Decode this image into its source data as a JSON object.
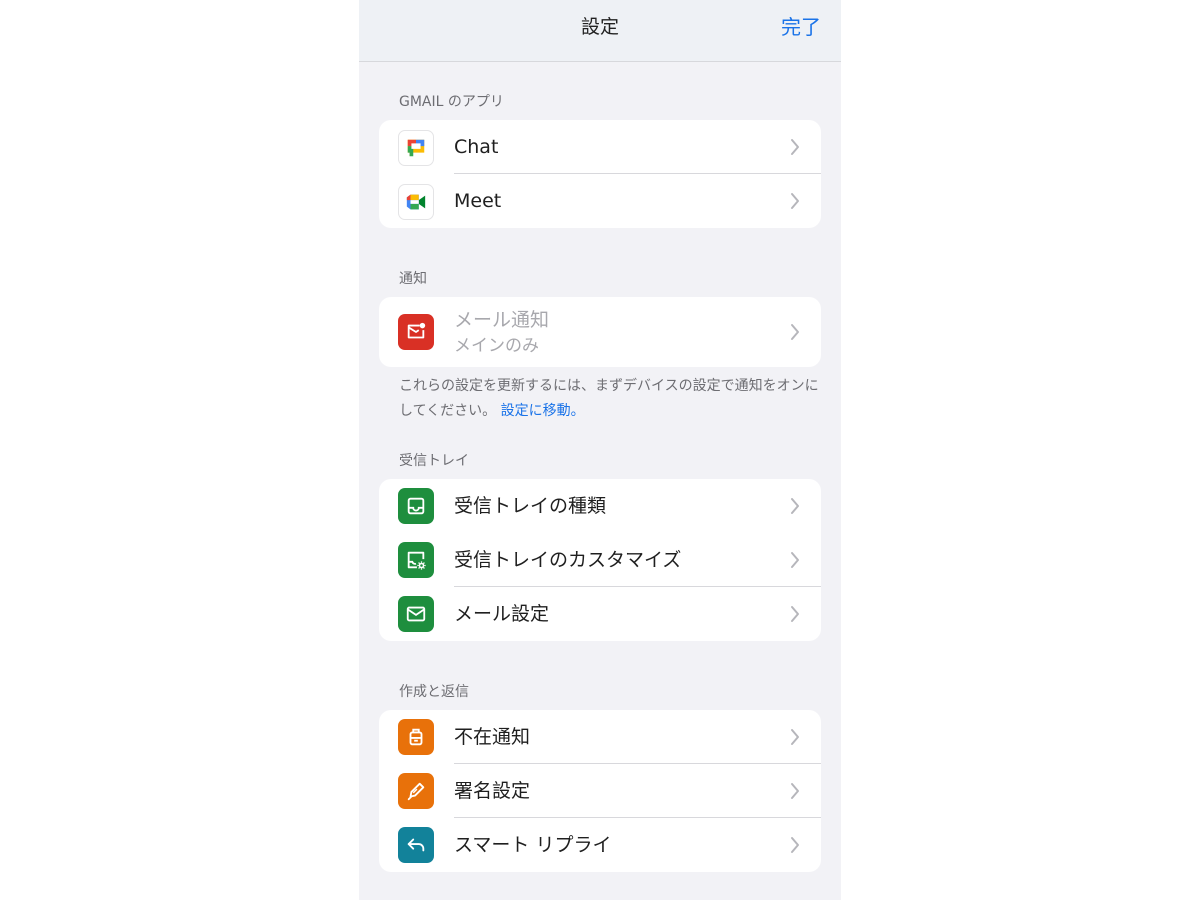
{
  "navbar": {
    "title": "設定",
    "done_label": "完了"
  },
  "sections": {
    "apps": {
      "header": "GMAIL のアプリ",
      "items": [
        {
          "label": "Chat",
          "icon": "google-chat-icon"
        },
        {
          "label": "Meet",
          "icon": "google-meet-icon"
        }
      ]
    },
    "notifications": {
      "header": "通知",
      "item": {
        "label": "メール通知",
        "sublabel": "メインのみ",
        "icon": "mail-notification-icon"
      },
      "footnote": "これらの設定を更新するには、まずデバイスの設定で通知をオンにしてください。",
      "footnote_link": "設定に移動。"
    },
    "inbox": {
      "header": "受信トレイ",
      "items": [
        {
          "label": "受信トレイの種類",
          "icon": "inbox-tray-icon"
        },
        {
          "label": "受信トレイのカスタマイズ",
          "icon": "inbox-customize-icon"
        },
        {
          "label": "メール設定",
          "icon": "envelope-icon"
        }
      ]
    },
    "compose": {
      "header": "作成と返信",
      "items": [
        {
          "label": "不在通知",
          "icon": "luggage-icon"
        },
        {
          "label": "署名設定",
          "icon": "pen-icon"
        },
        {
          "label": "スマート リプライ",
          "icon": "reply-arrow-icon"
        }
      ]
    }
  },
  "colors": {
    "accent": "#1a73e8",
    "inbox_green": "#1e8e3e",
    "notification_red": "#d93025",
    "compose_orange": "#e8710a",
    "reply_teal": "#12829a"
  }
}
